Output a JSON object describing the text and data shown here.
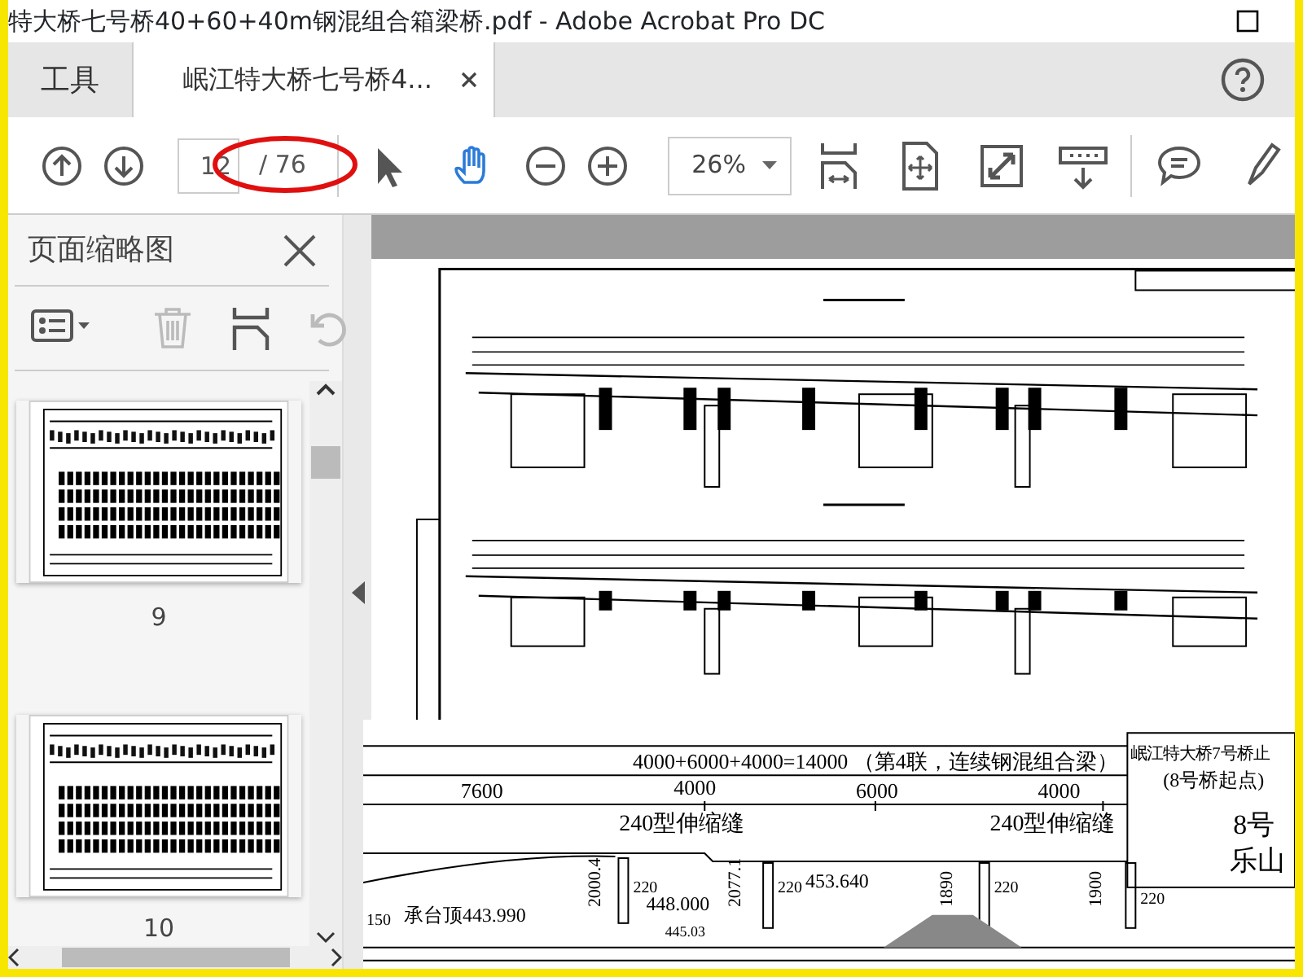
{
  "window": {
    "title": "特大桥七号桥40+60+40m钢混组合箱梁桥.pdf - Adobe Acrobat Pro DC"
  },
  "tabs": [
    {
      "label": "工具",
      "selected": false
    },
    {
      "label": "岷江特大桥七号桥4...",
      "selected": true
    }
  ],
  "toolbar": {
    "page_number": "12",
    "page_count": "/ 76",
    "zoom": "26%",
    "tools": [
      {
        "kind": "select",
        "selected": false
      },
      {
        "kind": "hand",
        "selected": true
      }
    ]
  },
  "side_panel": {
    "title": "页面缩略图",
    "actions": [
      {
        "kind": "options",
        "disabled": false
      },
      {
        "kind": "delete",
        "disabled": true
      },
      {
        "kind": "extract",
        "disabled": false
      },
      {
        "kind": "rotate",
        "disabled": true
      }
    ],
    "thumbnails": [
      {
        "label": "9"
      },
      {
        "label": "10"
      }
    ]
  },
  "sheet_labels": [
    "4000+6000+4000=14000 （第4联，连续钢混组合梁）",
    "7600",
    "4000",
    "6000",
    "4000",
    "240型伸缩缝",
    "240型伸缩缝",
    "岷江特大桥7号桥止",
    "(8号桥起点)",
    "8号",
    "乐山",
    "2000.4",
    "448.000",
    "2077.1",
    "453.640",
    "1890",
    "1900",
    "150",
    "承台顶443.990",
    "220",
    "220",
    "220",
    "220",
    "445.03"
  ]
}
